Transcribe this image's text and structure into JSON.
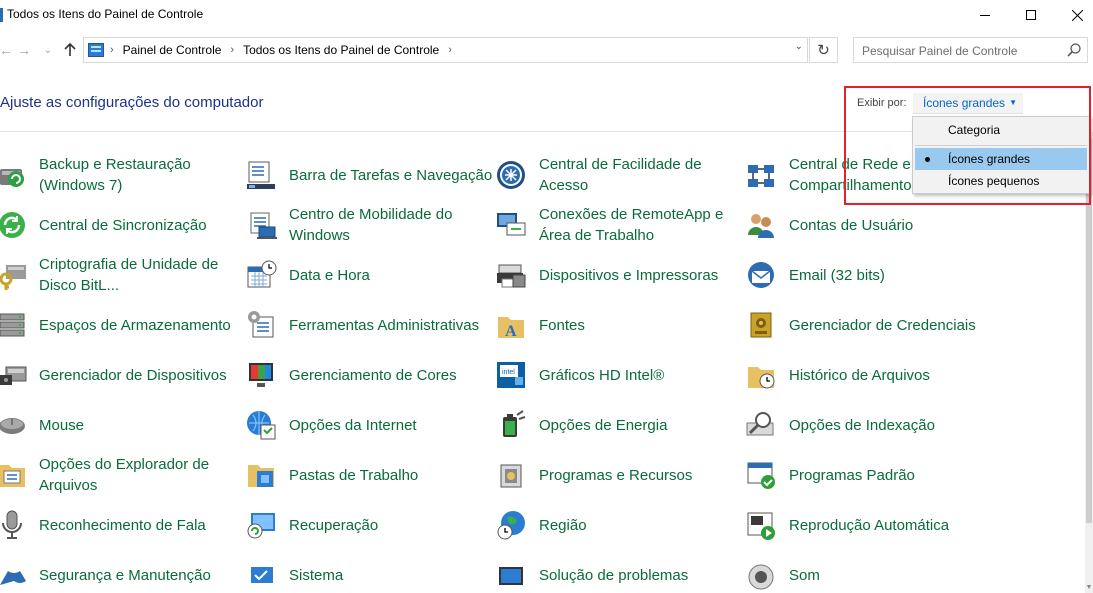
{
  "window": {
    "title": "Todos os Itens do Painel de Controle"
  },
  "address": {
    "crumbs": [
      "Painel de Controle",
      "Todos os Itens do Painel de Controle"
    ]
  },
  "search": {
    "placeholder": "Pesquisar Painel de Controle"
  },
  "header": {
    "heading": "Ajuste as configurações do computador",
    "view_label": "Exibir por:",
    "view_selected": "Ícones grandes"
  },
  "view_menu": {
    "options": [
      "Categoria",
      "Ícones grandes",
      "Ícones pequenos"
    ],
    "selected_index": 1
  },
  "items": [
    [
      "Backup e Restauração (Windows 7)",
      "Barra de Tarefas e Navegação",
      "Central de Facilidade de Acesso",
      "Central de Rede e Compartilhamento"
    ],
    [
      "Central de Sincronização",
      "Centro de Mobilidade do Windows",
      "Conexões de RemoteApp e Área de Trabalho",
      "Contas de Usuário"
    ],
    [
      "Criptografia de Unidade de Disco BitL...",
      "Data e Hora",
      "Dispositivos e Impressoras",
      "Email (32 bits)"
    ],
    [
      "Espaços de Armazenamento",
      "Ferramentas Administrativas",
      "Fontes",
      "Gerenciador de Credenciais"
    ],
    [
      "Gerenciador de Dispositivos",
      "Gerenciamento de Cores",
      "Gráficos HD Intel®",
      "Histórico de Arquivos"
    ],
    [
      "Mouse",
      "Opções da Internet",
      "Opções de Energia",
      "Opções de Indexação"
    ],
    [
      "Opções do Explorador de Arquivos",
      "Pastas de Trabalho",
      "Programas e Recursos",
      "Programas Padrão"
    ],
    [
      "Reconhecimento de Fala",
      "Recuperação",
      "Região",
      "Reprodução Automática"
    ],
    [
      "Segurança e Manutenção",
      "Sistema",
      "Solução de problemas",
      "Som"
    ]
  ],
  "colors": {
    "link_green": "#0a6b3a",
    "heading_blue": "#1e3287",
    "menu_highlight": "#99c9ef",
    "annotation_red": "#e3202b"
  }
}
